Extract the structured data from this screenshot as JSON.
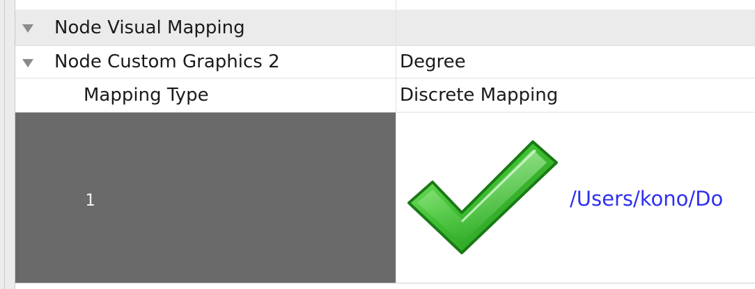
{
  "table": {
    "group_header": {
      "label": "Node Visual Mapping"
    },
    "property_row": {
      "label": "Node Custom Graphics 2",
      "value": "Degree"
    },
    "mapping_type_row": {
      "label": "Mapping Type",
      "value": "Discrete Mapping"
    },
    "mapping_entry": {
      "key": "1",
      "value_path": "/Users/kono/Do",
      "image_icon": "green-checkmark-icon"
    }
  },
  "colors": {
    "key_cell_background": "#6a6a6a",
    "header_background": "#ebebeb",
    "path_link_color": "#2f2ff2",
    "checkmark_green": "#2fb52f"
  }
}
